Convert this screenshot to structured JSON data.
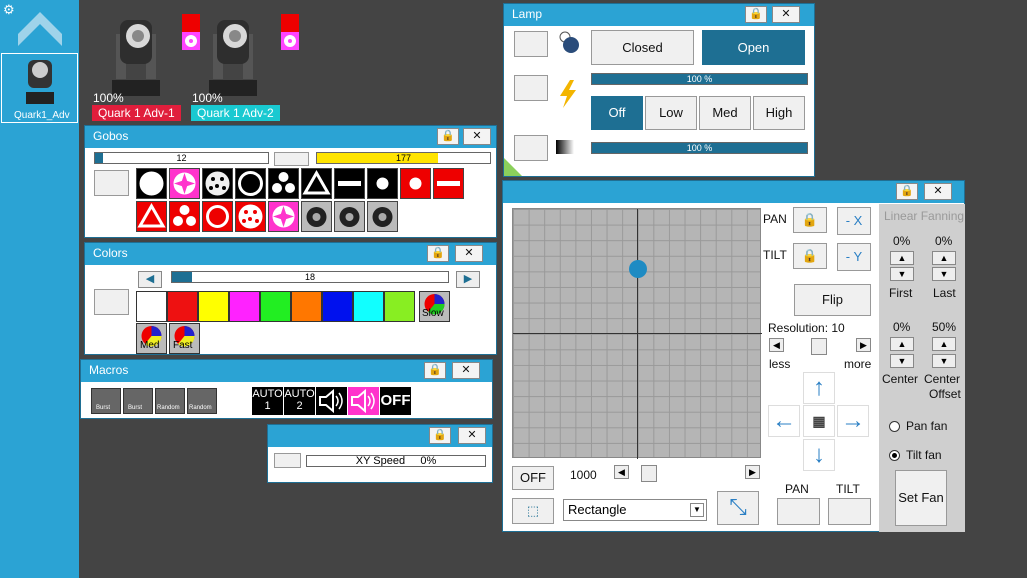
{
  "sidebar": {
    "fixture_label": "Quark1_Adv"
  },
  "fixtures": [
    {
      "percent": "100%",
      "name": "Quark 1 Adv-1",
      "color": "#e01e3c"
    },
    {
      "percent": "100%",
      "name": "Quark 1 Adv-2",
      "color": "#19c9d1"
    }
  ],
  "gobos": {
    "title": "Gobos",
    "slider_value": "12",
    "level_value": "177",
    "level_fraction": 0.7
  },
  "colors": {
    "title": "Colors",
    "slider_value": "18",
    "swatches": [
      "#ffffff",
      "#ee1111",
      "#ffff00",
      "#ff22ff",
      "#22ee22",
      "#ff7700",
      "#0011ee",
      "#11ffff",
      "#88ee22"
    ],
    "wheel_labels": [
      "Slow",
      "Med",
      "Fast"
    ]
  },
  "macros": {
    "title": "Macros",
    "items": [
      "Burst",
      "Burst",
      "Random",
      "Random"
    ],
    "auto1_top": "AUTO",
    "auto1_num": "1",
    "auto2_top": "AUTO",
    "auto2_num": "2",
    "off_label": "OFF"
  },
  "xyspeed": {
    "label": "XY Speed",
    "value": "0%"
  },
  "lamp": {
    "title": "Lamp",
    "closed_label": "Closed",
    "open_label": "Open",
    "dimmer_value": "100 %",
    "dimmer_fraction": 1.0,
    "off_label": "Off",
    "low_label": "Low",
    "med_label": "Med",
    "high_label": "High",
    "fade_value": "100 %",
    "fade_fraction": 1.0
  },
  "pantilt": {
    "pan_label": "PAN",
    "tilt_label": "TILT",
    "neg_x": "- X",
    "neg_y": "- Y",
    "flip_label": "Flip",
    "resolution_label": "Resolution: 10",
    "less_label": "less",
    "more_label": "more",
    "off_label": "OFF",
    "speed_value": "1000",
    "shape_value": "Rectangle",
    "pan_bottom_label": "PAN",
    "tilt_bottom_label": "TILT",
    "fanning_title": "Linear Fanning",
    "first_value": "0%",
    "last_value": "0%",
    "first_label": "First",
    "last_label": "Last",
    "center_value": "0%",
    "offset_value": "50%",
    "center_label": "Center",
    "center_offset_label1": "Center",
    "center_offset_label2": "Offset",
    "pan_fan_label": "Pan fan",
    "tilt_fan_label": "Tilt fan",
    "set_fan_label": "Set Fan",
    "dot_x": 0.5,
    "dot_y": 0.24
  }
}
